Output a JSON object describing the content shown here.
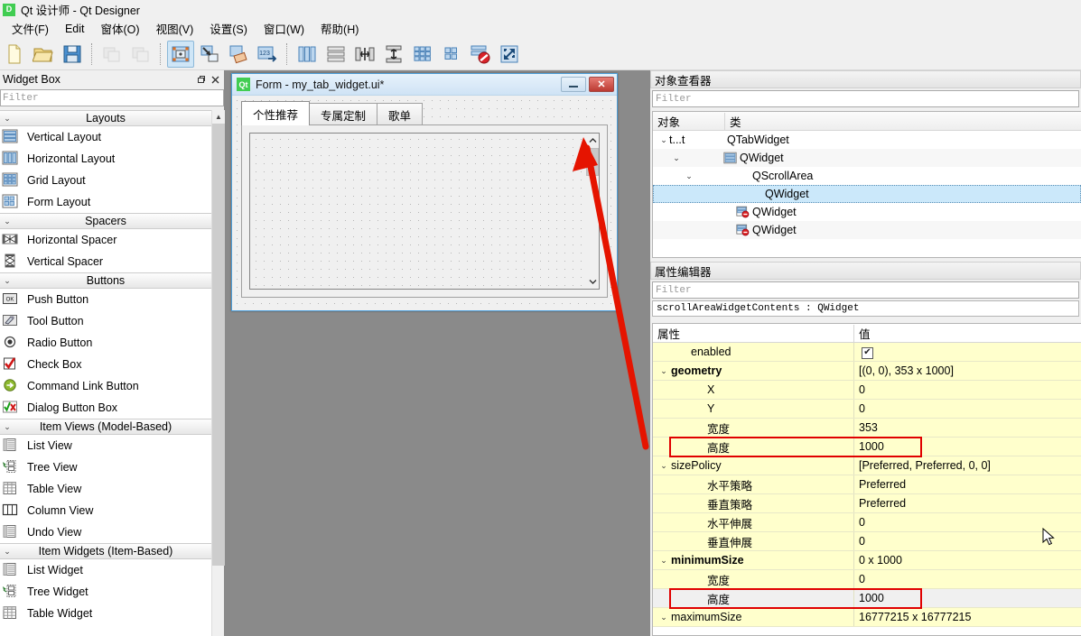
{
  "window": {
    "title": "Qt 设计师 - Qt Designer",
    "logo_text": "Qt",
    "logo_short": "D"
  },
  "menubar": {
    "items": [
      {
        "label": "文件(F)",
        "name": "menu-file"
      },
      {
        "label": "Edit",
        "name": "menu-edit"
      },
      {
        "label": "窗体(O)",
        "name": "menu-form"
      },
      {
        "label": "视图(V)",
        "name": "menu-view"
      },
      {
        "label": "设置(S)",
        "name": "menu-settings"
      },
      {
        "label": "窗口(W)",
        "name": "menu-window"
      },
      {
        "label": "帮助(H)",
        "name": "menu-help"
      }
    ]
  },
  "toolbar": {
    "buttons": [
      {
        "name": "new-form-icon",
        "group": 0,
        "active": false
      },
      {
        "name": "open-form-icon",
        "group": 0,
        "active": false
      },
      {
        "name": "save-form-icon",
        "group": 0,
        "active": false
      },
      {
        "name": "undo-icon",
        "group": 1,
        "active": false,
        "disabled": true
      },
      {
        "name": "redo-icon",
        "group": 1,
        "active": false,
        "disabled": true
      },
      {
        "name": "edit-widgets-icon",
        "group": 2,
        "active": true
      },
      {
        "name": "edit-signals-slots-icon",
        "group": 2,
        "active": false
      },
      {
        "name": "edit-buddies-icon",
        "group": 2,
        "active": false
      },
      {
        "name": "edit-tab-order-icon",
        "group": 2,
        "active": false
      },
      {
        "name": "layout-horizontally-icon",
        "group": 3,
        "active": false
      },
      {
        "name": "layout-vertically-icon",
        "group": 3,
        "active": false
      },
      {
        "name": "layout-splitter-horizontal-icon",
        "group": 3,
        "active": false
      },
      {
        "name": "layout-splitter-vertical-icon",
        "group": 3,
        "active": false
      },
      {
        "name": "layout-grid-icon",
        "group": 3,
        "active": false
      },
      {
        "name": "layout-form-icon",
        "group": 3,
        "active": false
      },
      {
        "name": "break-layout-icon",
        "group": 3,
        "active": false
      },
      {
        "name": "adjust-size-icon",
        "group": 3,
        "active": false
      }
    ]
  },
  "widget_box": {
    "title": "Widget Box",
    "float_icon": "restore-icon",
    "close_icon": "close-icon",
    "filter_placeholder": "Filter",
    "filter_value": "",
    "categories": [
      {
        "name": "Layouts",
        "expanded": true,
        "items": [
          {
            "label": "Vertical Layout",
            "icon": "vertical-layout-icon"
          },
          {
            "label": "Horizontal Layout",
            "icon": "horizontal-layout-icon"
          },
          {
            "label": "Grid Layout",
            "icon": "grid-layout-icon"
          },
          {
            "label": "Form Layout",
            "icon": "form-layout-icon"
          }
        ]
      },
      {
        "name": "Spacers",
        "expanded": true,
        "items": [
          {
            "label": "Horizontal Spacer",
            "icon": "horizontal-spacer-icon"
          },
          {
            "label": "Vertical Spacer",
            "icon": "vertical-spacer-icon"
          }
        ]
      },
      {
        "name": "Buttons",
        "expanded": true,
        "items": [
          {
            "label": "Push Button",
            "icon": "push-button-icon"
          },
          {
            "label": "Tool Button",
            "icon": "tool-button-icon"
          },
          {
            "label": "Radio Button",
            "icon": "radio-button-icon"
          },
          {
            "label": "Check Box",
            "icon": "check-box-icon"
          },
          {
            "label": "Command Link Button",
            "icon": "command-link-button-icon"
          },
          {
            "label": "Dialog Button Box",
            "icon": "dialog-button-box-icon"
          }
        ]
      },
      {
        "name": "Item Views (Model-Based)",
        "expanded": true,
        "items": [
          {
            "label": "List View",
            "icon": "list-view-icon"
          },
          {
            "label": "Tree View",
            "icon": "tree-view-icon"
          },
          {
            "label": "Table View",
            "icon": "table-view-icon"
          },
          {
            "label": "Column View",
            "icon": "column-view-icon"
          },
          {
            "label": "Undo View",
            "icon": "undo-view-icon"
          }
        ]
      },
      {
        "name": "Item Widgets (Item-Based)",
        "expanded": true,
        "items": [
          {
            "label": "List Widget",
            "icon": "list-widget-icon"
          },
          {
            "label": "Tree Widget",
            "icon": "tree-widget-icon"
          },
          {
            "label": "Table Widget",
            "icon": "table-widget-icon"
          }
        ]
      }
    ]
  },
  "form_window": {
    "title": "Form - my_tab_widget.ui*",
    "logo": "Qt",
    "minimize_label": "minimize-icon",
    "close_label": "✕",
    "tabs": [
      {
        "label": "个性推荐",
        "selected": true
      },
      {
        "label": "专属定制",
        "selected": false
      },
      {
        "label": "歌单",
        "selected": false
      }
    ]
  },
  "object_inspector": {
    "title": "对象查看器",
    "filter_placeholder": "Filter",
    "filter_value": "",
    "columns": [
      "对象",
      "类"
    ],
    "rows": [
      {
        "object": "t...t",
        "class": "QTabWidget",
        "depth": 1,
        "chevron": "v",
        "icon": "",
        "selected": false
      },
      {
        "object": "",
        "class": "QWidget",
        "depth": 2,
        "chevron": "v",
        "icon": "vertical-layout-icon",
        "selected": false
      },
      {
        "object": "",
        "class": "QScrollArea",
        "depth": 3,
        "chevron": "v",
        "icon": "",
        "selected": false
      },
      {
        "object": "",
        "class": "QWidget",
        "depth": 4,
        "chevron": "",
        "icon": "",
        "selected": true
      },
      {
        "object": "",
        "class": "QWidget",
        "depth": 3,
        "chevron": "",
        "icon": "no-layout-icon",
        "selected": false
      },
      {
        "object": "",
        "class": "QWidget",
        "depth": 3,
        "chevron": "",
        "icon": "no-layout-icon",
        "selected": false
      }
    ]
  },
  "property_editor": {
    "title": "属性编辑器",
    "filter_placeholder": "Filter",
    "filter_value": "",
    "object_header": "scrollAreaWidgetContents : QWidget",
    "columns": [
      "属性",
      "值"
    ],
    "rows": [
      {
        "name": "enabled",
        "value": "",
        "indent": 1,
        "chevron": "",
        "bold": false,
        "bg": "yellow",
        "checkbox": true,
        "checked": true,
        "highlight": false
      },
      {
        "name": "geometry",
        "value": "[(0, 0), 353 x 1000]",
        "indent": 0,
        "chevron": "v",
        "bold": true,
        "bg": "yellow",
        "checkbox": false,
        "checked": false,
        "highlight": false
      },
      {
        "name": "X",
        "value": "0",
        "indent": 2,
        "chevron": "",
        "bold": false,
        "bg": "yellow",
        "checkbox": false,
        "checked": false,
        "highlight": false
      },
      {
        "name": "Y",
        "value": "0",
        "indent": 2,
        "chevron": "",
        "bold": false,
        "bg": "yellow",
        "checkbox": false,
        "checked": false,
        "highlight": false
      },
      {
        "name": "宽度",
        "value": "353",
        "indent": 2,
        "chevron": "",
        "bold": false,
        "bg": "yellow",
        "checkbox": false,
        "checked": false,
        "highlight": false
      },
      {
        "name": "高度",
        "value": "1000",
        "indent": 2,
        "chevron": "",
        "bold": false,
        "bg": "yellow",
        "checkbox": false,
        "checked": false,
        "highlight": true
      },
      {
        "name": "sizePolicy",
        "value": "[Preferred, Preferred, 0, 0]",
        "indent": 0,
        "chevron": "v",
        "bold": false,
        "bg": "yellow",
        "checkbox": false,
        "checked": false,
        "highlight": false
      },
      {
        "name": "水平策略",
        "value": "Preferred",
        "indent": 2,
        "chevron": "",
        "bold": false,
        "bg": "yellow",
        "checkbox": false,
        "checked": false,
        "highlight": false
      },
      {
        "name": "垂直策略",
        "value": "Preferred",
        "indent": 2,
        "chevron": "",
        "bold": false,
        "bg": "yellow",
        "checkbox": false,
        "checked": false,
        "highlight": false
      },
      {
        "name": "水平伸展",
        "value": "0",
        "indent": 2,
        "chevron": "",
        "bold": false,
        "bg": "yellow",
        "checkbox": false,
        "checked": false,
        "highlight": false
      },
      {
        "name": "垂直伸展",
        "value": "0",
        "indent": 2,
        "chevron": "",
        "bold": false,
        "bg": "yellow",
        "checkbox": false,
        "checked": false,
        "highlight": false
      },
      {
        "name": "minimumSize",
        "value": "0 x 1000",
        "indent": 0,
        "chevron": "v",
        "bold": true,
        "bg": "yellow",
        "checkbox": false,
        "checked": false,
        "highlight": false
      },
      {
        "name": "宽度",
        "value": "0",
        "indent": 2,
        "chevron": "",
        "bold": false,
        "bg": "yellow",
        "checkbox": false,
        "checked": false,
        "highlight": false
      },
      {
        "name": "高度",
        "value": "1000",
        "indent": 2,
        "chevron": "",
        "bold": false,
        "bg": "grey",
        "checkbox": false,
        "checked": false,
        "highlight": true
      },
      {
        "name": "maximumSize",
        "value": "16777215 x 16777215",
        "indent": 0,
        "chevron": "v",
        "bold": false,
        "bg": "yellow",
        "checkbox": false,
        "checked": false,
        "highlight": false
      }
    ]
  },
  "annotations": {
    "arrow_color": "#e51400",
    "highlight_color": "#e00000"
  }
}
